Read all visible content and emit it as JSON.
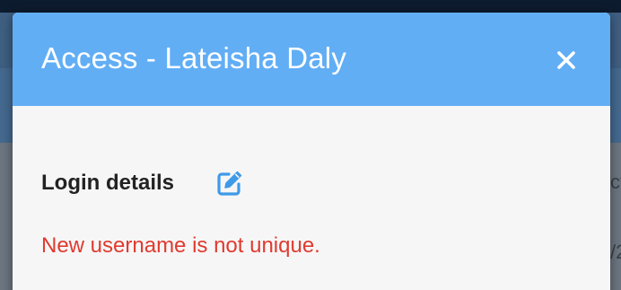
{
  "modal": {
    "title": "Access - Lateisha Daly",
    "close_icon": "close-icon",
    "header_color": "#62aef5"
  },
  "login_details": {
    "heading": "Login details",
    "edit_icon": "edit-icon",
    "edit_icon_color": "#3f9ae8"
  },
  "error": {
    "message": "New username is not unique.",
    "color": "#e03a2f"
  },
  "background": {
    "partial_text_1": "ct",
    "partial_text_2": "/2"
  }
}
